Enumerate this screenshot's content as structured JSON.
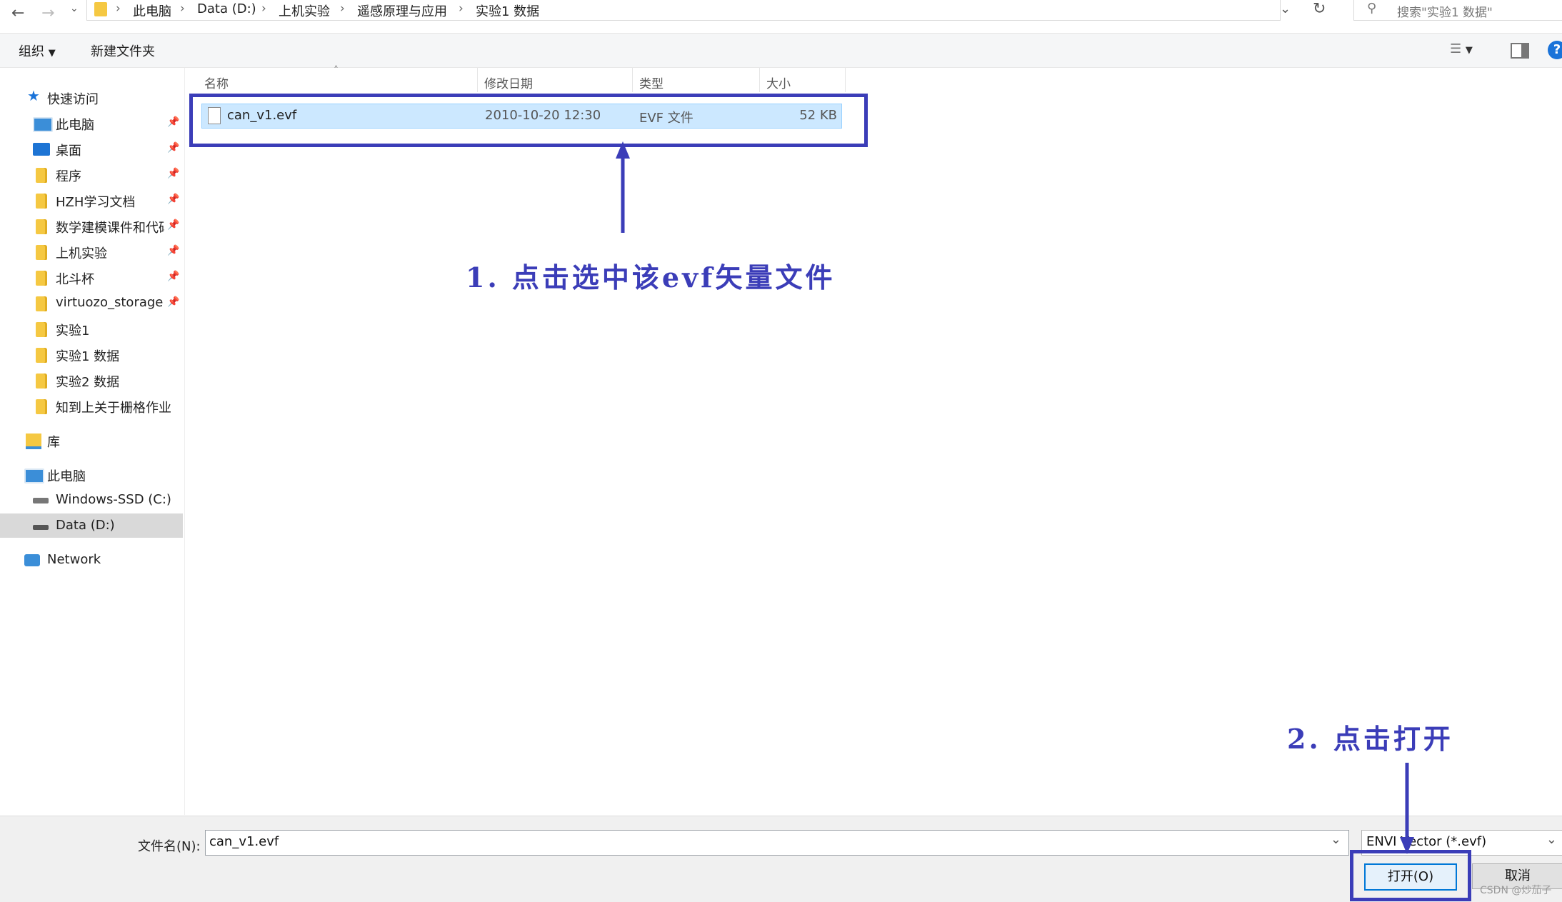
{
  "address_bar": {
    "crumbs": [
      "此电脑",
      "Data (D:)",
      "上机实验",
      "遥感原理与应用",
      "实验1 数据"
    ],
    "search_placeholder": "搜索\"实验1 数据\""
  },
  "command_bar": {
    "organize_label": "组织",
    "new_folder_label": "新建文件夹"
  },
  "nav": {
    "quick_access": "快速访问",
    "pinned": [
      "此电脑",
      "桌面",
      "程序",
      "HZH学习文档",
      "数学建模课件和代码",
      "上机实验",
      "北斗杯",
      "virtuozo_storage"
    ],
    "recent": [
      "实验1",
      "实验1 数据",
      "实验2 数据",
      "知到上关于栅格作业"
    ],
    "library": "库",
    "this_pc": "此电脑",
    "drives": [
      "Windows-SSD (C:)",
      "Data (D:)"
    ],
    "network": "Network"
  },
  "columns": {
    "name": "名称",
    "modified": "修改日期",
    "type": "类型",
    "size": "大小"
  },
  "file": {
    "name": "can_v1.evf",
    "modified": "2010-10-20 12:30",
    "type": "EVF 文件",
    "size": "52 KB"
  },
  "annotations": {
    "step1": "1. 点击选中该evf矢量文件",
    "step2": "2. 点击打开"
  },
  "bottom": {
    "filename_label": "文件名(N):",
    "filename_value": "can_v1.evf",
    "filter_value": "ENVI Vector (*.evf)",
    "open_label": "打开(O)",
    "cancel_label": "取消",
    "watermark": "CSDN @炒茄子"
  },
  "colors": {
    "annotation": "#3b3db8",
    "selection": "#cce8ff"
  }
}
